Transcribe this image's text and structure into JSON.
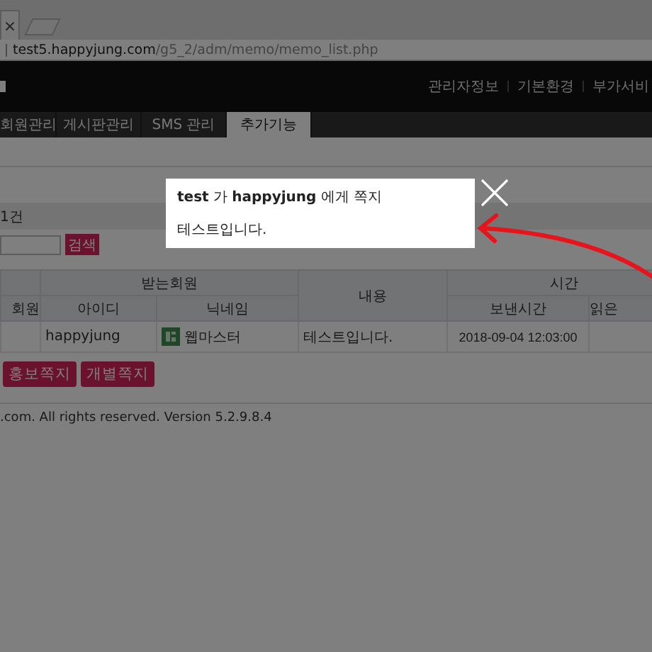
{
  "browser": {
    "tab_close": "×",
    "url_host": "test5.happyjung.com",
    "url_path": "/g5_2/adm/memo/memo_list.php"
  },
  "header": {
    "links": [
      "관리자정보",
      "기본환경",
      "부가서비"
    ]
  },
  "nav": [
    {
      "label": "회원관리",
      "selected": false
    },
    {
      "label": "게시판관리",
      "selected": false
    },
    {
      "label": "SMS 관리",
      "selected": false
    },
    {
      "label": "추가기능",
      "selected": true
    }
  ],
  "count": "1건",
  "search": {
    "button": "검색"
  },
  "table": {
    "group_headers": [
      "받는회원",
      "내용",
      "시간"
    ],
    "columns": [
      "회원",
      "아이디",
      "닉네임",
      "보낸시간",
      "읽은"
    ],
    "rows": [
      {
        "id": "happyjung",
        "nickname": "웹마스터",
        "content": "테스트입니다.",
        "sent": "2018-09-04 12:03:00"
      }
    ]
  },
  "buttons": [
    "홍보쪽지",
    "개별쪽지"
  ],
  "footer": ".com.  All rights reserved. Version 5.2.9.8.4",
  "popup": {
    "title": "**test** 가 **happyjung** 에게 쪽지",
    "body": "테스트입니다."
  }
}
